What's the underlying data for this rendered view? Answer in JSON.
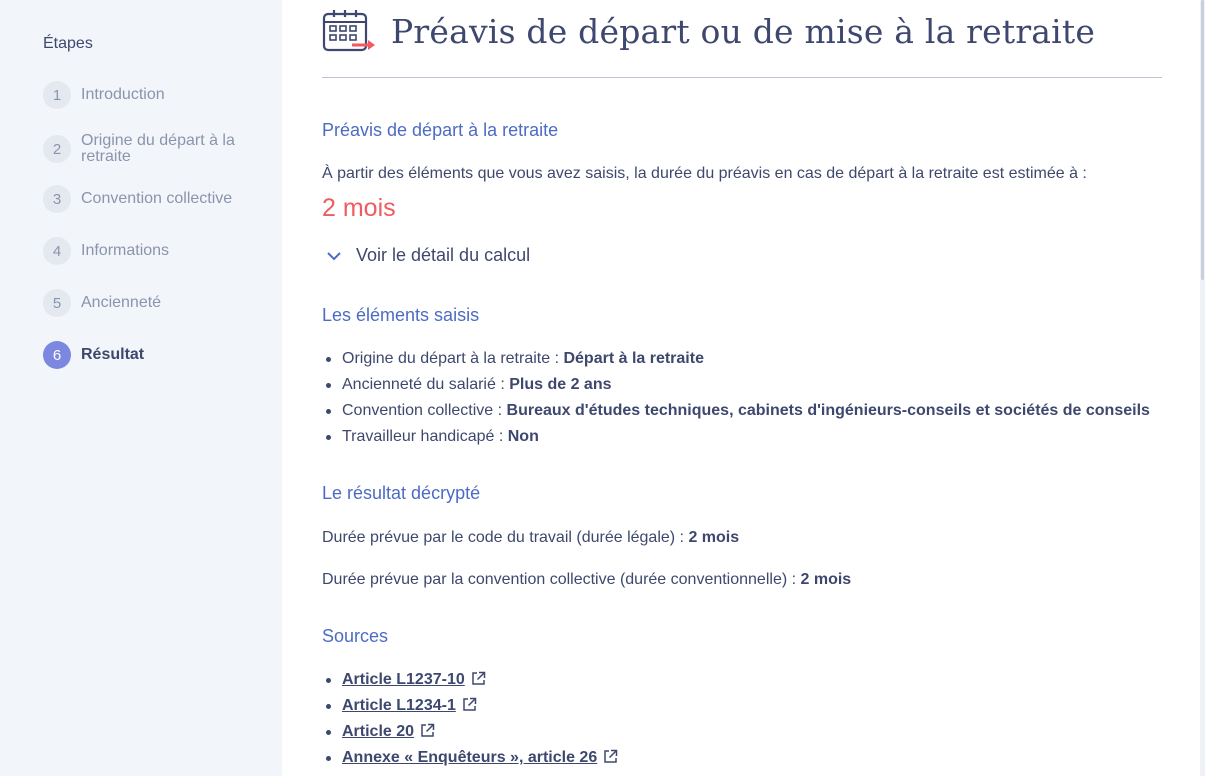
{
  "sidebar": {
    "title": "Étapes",
    "steps": [
      {
        "num": "1",
        "label": "Introduction"
      },
      {
        "num": "2",
        "label": "Origine du départ à la retraite"
      },
      {
        "num": "3",
        "label": "Convention collective"
      },
      {
        "num": "4",
        "label": "Informations"
      },
      {
        "num": "5",
        "label": "Ancienneté"
      },
      {
        "num": "6",
        "label": "Résultat"
      }
    ],
    "active_step": "6"
  },
  "header": {
    "title": "Préavis de départ ou de mise à la retraite",
    "icon": "calendar-arrow-icon"
  },
  "result_section": {
    "heading": "Préavis de départ à la retraite",
    "intro": "À partir des éléments que vous avez saisis, la durée du préavis en cas de départ à la retraite est estimée à :",
    "value": "2 mois",
    "toggle_label": "Voir le détail du calcul"
  },
  "elements_section": {
    "heading": "Les éléments saisis",
    "items": [
      {
        "label": "Origine du départ à la retraite :",
        "value": "Départ à la retraite"
      },
      {
        "label": "Ancienneté du salarié :",
        "value": "Plus de 2 ans"
      },
      {
        "label": "Convention collective :",
        "value": "Bureaux d'études techniques, cabinets d'ingénieurs-conseils et sociétés de conseils"
      },
      {
        "label": "Travailleur handicapé :",
        "value": "Non"
      }
    ]
  },
  "decrypt_section": {
    "heading": "Le résultat décrypté",
    "legal_label": "Durée prévue par le code du travail (durée légale) :",
    "legal_value": "2 mois",
    "conv_label": "Durée prévue par la convention collective (durée conventionnelle) :",
    "conv_value": "2 mois"
  },
  "sources_section": {
    "heading": "Sources",
    "links": [
      {
        "label": "Article L1237-10"
      },
      {
        "label": "Article L1234-1"
      },
      {
        "label": "Article 20"
      },
      {
        "label": "Annexe « Enquêteurs », article 26"
      }
    ]
  },
  "colors": {
    "accent": "#4c6bc4",
    "result": "#f15a5f",
    "active_step": "#7c88e0",
    "text": "#3e486e"
  }
}
